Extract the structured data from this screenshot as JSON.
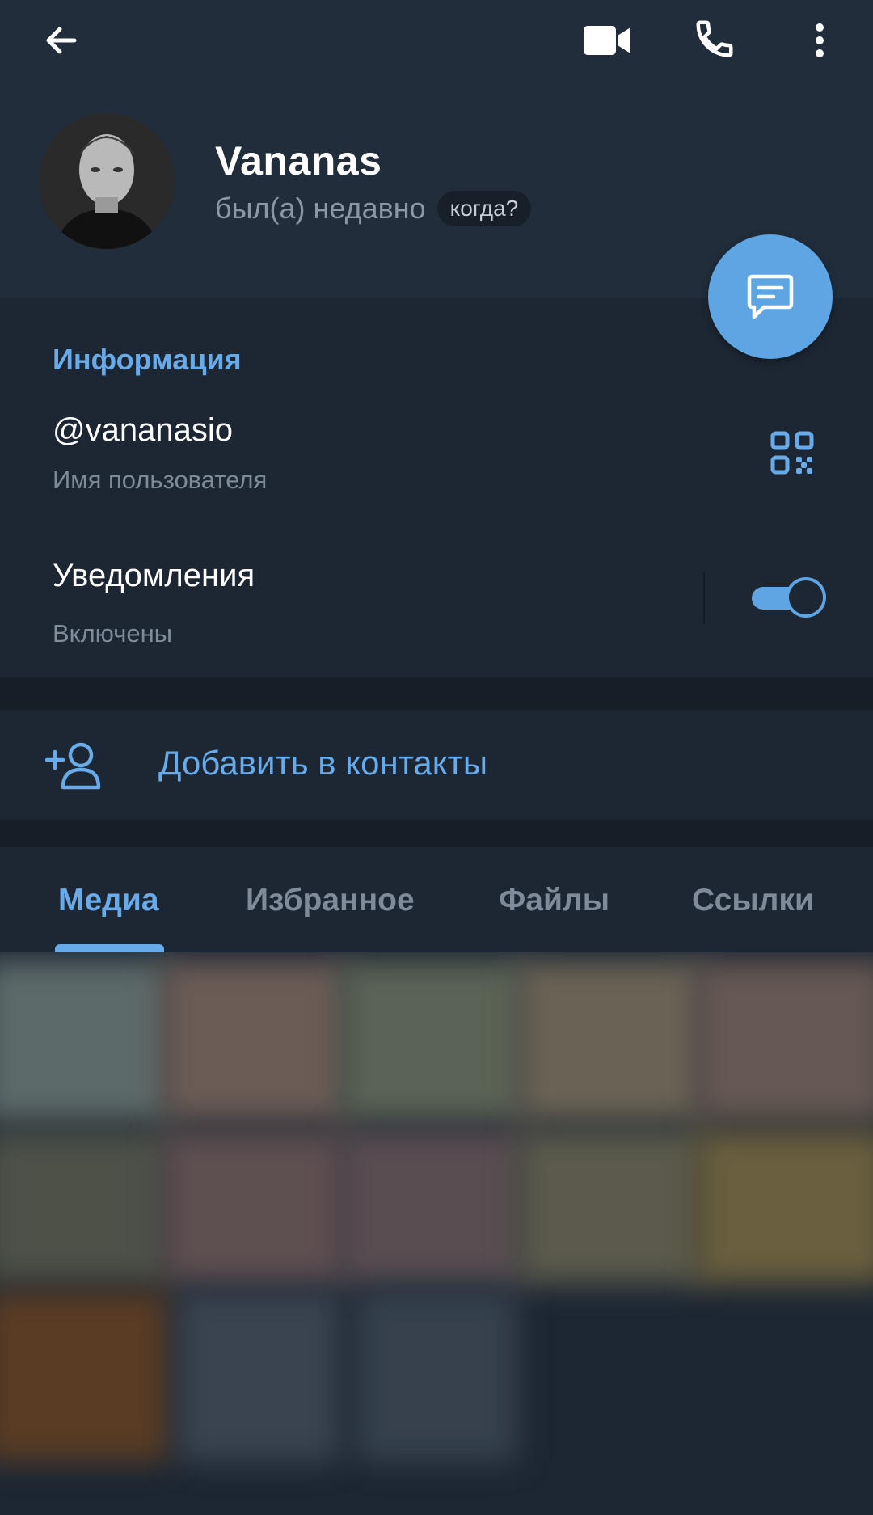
{
  "header": {
    "back_icon": "arrow-left-icon",
    "video_icon": "video-camera-icon",
    "call_icon": "phone-icon",
    "menu_icon": "more-vertical-icon",
    "name": "Vananas",
    "status": "был(а) недавно",
    "when_pill": "когда?"
  },
  "fab": {
    "icon": "message-icon"
  },
  "info": {
    "section_title": "Информация",
    "username": "@vananasio",
    "username_caption": "Имя пользователя",
    "qr_icon": "qr-code-icon",
    "notifications_title": "Уведомления",
    "notifications_caption": "Включены",
    "notifications_enabled": true
  },
  "add_contact": {
    "icon": "add-user-icon",
    "label": "Добавить в контакты"
  },
  "tabs": [
    {
      "label": "Медиа",
      "active": true
    },
    {
      "label": "Избранное",
      "active": false
    },
    {
      "label": "Файлы",
      "active": false
    },
    {
      "label": "Ссылки",
      "active": false
    }
  ],
  "colors": {
    "accent": "#67abea",
    "fab": "#5ea5e3",
    "header_bg": "#212d3b",
    "body_bg": "#1d2733",
    "separator_bg": "#161f28"
  }
}
